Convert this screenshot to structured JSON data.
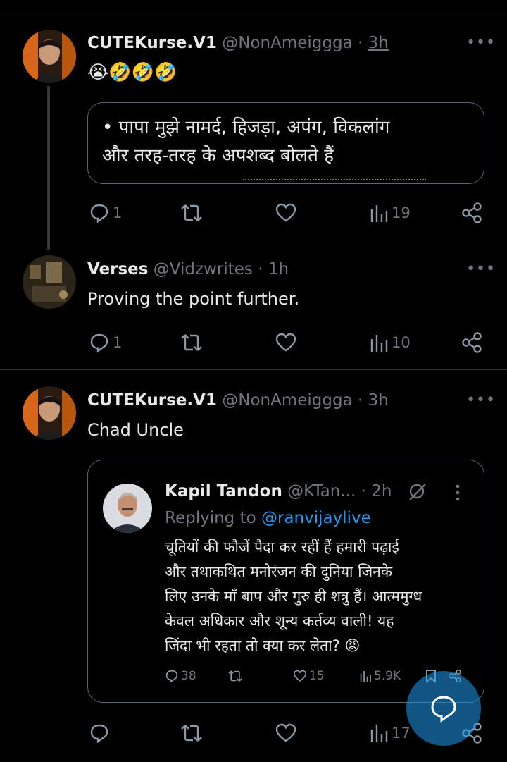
{
  "tweets": [
    {
      "name": "CUTEKurse.V1",
      "handle": "@NonAmeiggga",
      "dot": "·",
      "time": "3h",
      "emojis": "😭🤣🤣🤣",
      "card_lines": [
        "• पापा मुझे नामर्द, हिजड़ा, अपंग, विकलांग",
        "और तरह-तरह के अपशब्द बोलते हैं"
      ],
      "replies": "1",
      "retweets": "",
      "likes": "",
      "views": "19"
    },
    {
      "name": "Verses",
      "handle": "@Vidzwrites",
      "dot": "·",
      "time": "1h",
      "text": "Proving the point further.",
      "replies": "1",
      "retweets": "",
      "likes": "",
      "views": "10"
    },
    {
      "name": "CUTEKurse.V1",
      "handle": "@NonAmeiggga",
      "dot": "·",
      "time": "3h",
      "text": "Chad Uncle",
      "replies": "",
      "retweets": "",
      "likes": "",
      "views": "17"
    }
  ],
  "quoted": {
    "name": "Kapil Tandon",
    "handle": "@KTan...",
    "dot": "·",
    "time": "2h",
    "replying_prefix": "Replying to",
    "replying_to": "@ranvijaylive",
    "lines": [
      "चूतियों की फौजें पैदा कर रहीं हैं हमारी पढ़ाई",
      "और तथाकथित मनोरंजन की दुनिया जिनके",
      "लिए उनके माँ बाप और गुरु ही शत्रु हैं। आत्ममुग्ध",
      "केवल अधिकार और शून्य कर्तव्य वाली! यह",
      "जिंदा भी रहता तो क्या कर लेता? 😡"
    ],
    "replies": "38",
    "likes": "15",
    "views": "5.9K"
  },
  "more_glyph": "•••",
  "colors": {
    "background": "#000000",
    "text": "#e7e9ea",
    "muted": "#71767b",
    "link": "#1d9bf0",
    "border": "#2f3336"
  }
}
